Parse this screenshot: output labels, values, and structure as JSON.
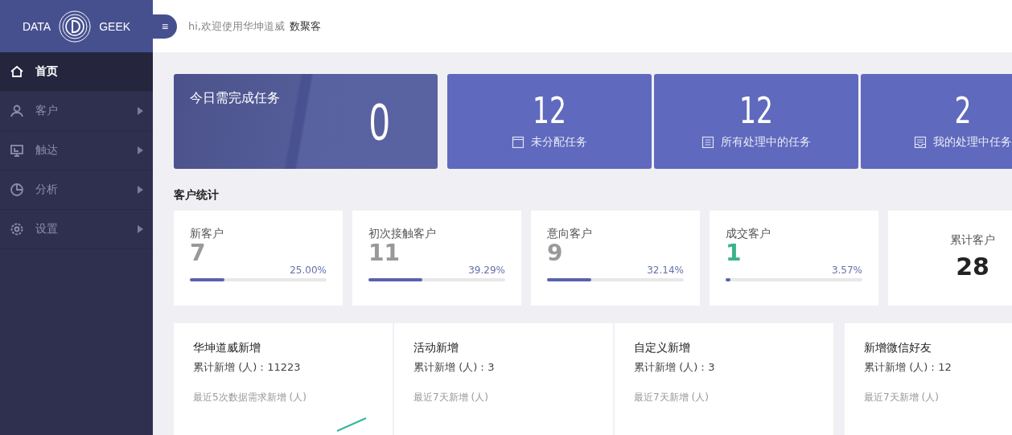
{
  "logo": {
    "left": "DATA",
    "right": "GEEK"
  },
  "header": {
    "menu_toggle": "≡",
    "greeting": "hi,欢迎使用华坤道威",
    "user": "数聚客"
  },
  "sidebar": {
    "items": [
      {
        "label": "首页",
        "selected": true,
        "has_submenu": false
      },
      {
        "label": "客户",
        "selected": false,
        "has_submenu": true
      },
      {
        "label": "触达",
        "selected": false,
        "has_submenu": true
      },
      {
        "label": "分析",
        "selected": false,
        "has_submenu": true
      },
      {
        "label": "设置",
        "selected": false,
        "has_submenu": true
      }
    ]
  },
  "today_task": {
    "title": "今日需完成任务",
    "count": "0"
  },
  "task_cards": [
    {
      "count": "12",
      "label": "未分配任务"
    },
    {
      "count": "12",
      "label": "所有处理中的任务"
    },
    {
      "count": "2",
      "label": "我的处理中任务"
    }
  ],
  "customer_stats": {
    "title": "客户统计",
    "cards": [
      {
        "kind": "progress",
        "label": "新客户",
        "value": "7",
        "percent": "25.00%",
        "level": 0.25,
        "color": "#999999"
      },
      {
        "kind": "progress",
        "label": "初次接触客户",
        "value": "11",
        "percent": "39.29%",
        "level": 0.3929,
        "color": "#999999"
      },
      {
        "kind": "progress",
        "label": "意向客户",
        "value": "9",
        "percent": "32.14%",
        "level": 0.3214,
        "color": "#999999"
      },
      {
        "kind": "progress",
        "label": "成交客户",
        "value": "1",
        "percent": "3.57%",
        "level": 0.0357,
        "color": "#3bb38a"
      },
      {
        "kind": "total",
        "label": "累计客户",
        "value": "28"
      }
    ]
  },
  "growth_cards": [
    {
      "title": "华坤道威新增",
      "total": "累计新增 (人)：11223",
      "subtitle": "最近5次数据需求新增 (人)",
      "has_chart": true
    },
    {
      "title": "活动新增",
      "total": "累计新增 (人)：3",
      "subtitle": "最近7天新增 (人)",
      "has_chart": false
    },
    {
      "title": "自定义新增",
      "total": "累计新增 (人)：3",
      "subtitle": "最近7天新增 (人)",
      "has_chart": false
    },
    {
      "title": "新增微信好友",
      "total": "累计新增 (人)：12",
      "subtitle": "最近7天新增 (人)",
      "has_chart": false
    }
  ]
}
